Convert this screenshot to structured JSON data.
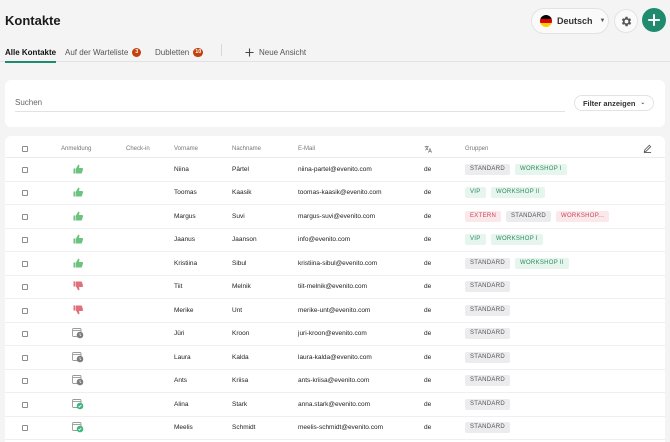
{
  "header": {
    "title": "Kontakte",
    "language_label": "Deutsch",
    "flag_colors": [
      "#000000",
      "#dd0000",
      "#ffce00"
    ],
    "accent_color": "#1f8a6e"
  },
  "tabs": [
    {
      "label": "Alle Kontakte",
      "count": null,
      "active": true
    },
    {
      "label": "Auf der Warteliste",
      "count": "3",
      "active": false
    },
    {
      "label": "Dubletten",
      "count": "10",
      "active": false
    }
  ],
  "new_view_label": "Neue Ansicht",
  "search": {
    "placeholder": "Suchen",
    "value": ""
  },
  "filter_label": "Filter anzeigen",
  "table": {
    "columns": {
      "registration": "Anmeldung",
      "checkin": "Check-in",
      "firstname": "Vorname",
      "lastname": "Nachname",
      "email": "E-Mail",
      "language_icon": "translate-icon",
      "groups": "Gruppen"
    },
    "rows": [
      {
        "status": "accepted",
        "firstname": "Niina",
        "lastname": "Pärtel",
        "email": "niina-partel@evenito.com",
        "lang": "de",
        "groups": [
          {
            "label": "STANDARD",
            "style": "standard"
          },
          {
            "label": "WORKSHOP I",
            "style": "green"
          }
        ]
      },
      {
        "status": "accepted",
        "firstname": "Toomas",
        "lastname": "Kaasik",
        "email": "toomas-kaasik@evenito.com",
        "lang": "de",
        "groups": [
          {
            "label": "VIP",
            "style": "green"
          },
          {
            "label": "WORKSHOP II",
            "style": "green"
          }
        ]
      },
      {
        "status": "accepted",
        "firstname": "Margus",
        "lastname": "Suvi",
        "email": "margus-suvi@evenito.com",
        "lang": "de",
        "groups": [
          {
            "label": "EXTERN",
            "style": "red"
          },
          {
            "label": "STANDARD",
            "style": "standard"
          },
          {
            "label": "WORKSHOP...",
            "style": "red"
          }
        ]
      },
      {
        "status": "accepted",
        "firstname": "Jaanus",
        "lastname": "Jaanson",
        "email": "info@evenito.com",
        "lang": "de",
        "groups": [
          {
            "label": "VIP",
            "style": "green"
          },
          {
            "label": "WORKSHOP I",
            "style": "green"
          }
        ]
      },
      {
        "status": "accepted",
        "firstname": "Kristiina",
        "lastname": "Sibul",
        "email": "kristiina-sibul@evenito.com",
        "lang": "de",
        "groups": [
          {
            "label": "STANDARD",
            "style": "standard"
          },
          {
            "label": "WORKSHOP II",
            "style": "green"
          }
        ]
      },
      {
        "status": "declined",
        "firstname": "Tiit",
        "lastname": "Melnik",
        "email": "tiit-melnik@evenito.com",
        "lang": "de",
        "groups": [
          {
            "label": "STANDARD",
            "style": "standard"
          }
        ]
      },
      {
        "status": "declined",
        "firstname": "Merike",
        "lastname": "Unt",
        "email": "merike-unt@evenito.com",
        "lang": "de",
        "groups": [
          {
            "label": "STANDARD",
            "style": "standard"
          }
        ]
      },
      {
        "status": "pending",
        "firstname": "Jüri",
        "lastname": "Kroon",
        "email": "juri-kroon@evenito.com",
        "lang": "de",
        "groups": [
          {
            "label": "STANDARD",
            "style": "standard"
          }
        ]
      },
      {
        "status": "pending",
        "firstname": "Laura",
        "lastname": "Kalda",
        "email": "laura-kalda@evenito.com",
        "lang": "de",
        "groups": [
          {
            "label": "STANDARD",
            "style": "standard"
          }
        ]
      },
      {
        "status": "pending",
        "firstname": "Ants",
        "lastname": "Kriisa",
        "email": "ants-kriisa@evenito.com",
        "lang": "de",
        "groups": [
          {
            "label": "STANDARD",
            "style": "standard"
          }
        ]
      },
      {
        "status": "invited",
        "firstname": "Alina",
        "lastname": "Stark",
        "email": "anna.stark@evenito.com",
        "lang": "de",
        "groups": [
          {
            "label": "STANDARD",
            "style": "standard"
          }
        ]
      },
      {
        "status": "invited",
        "firstname": "Meelis",
        "lastname": "Schmidt",
        "email": "meelis-schmidt@evenito.com",
        "lang": "de",
        "groups": [
          {
            "label": "STANDARD",
            "style": "standard"
          }
        ]
      }
    ]
  },
  "status_colors": {
    "accepted": "#6cc27f",
    "declined": "#e0707c",
    "pending": "#9a9a9a",
    "invited": "#3fb57f"
  }
}
